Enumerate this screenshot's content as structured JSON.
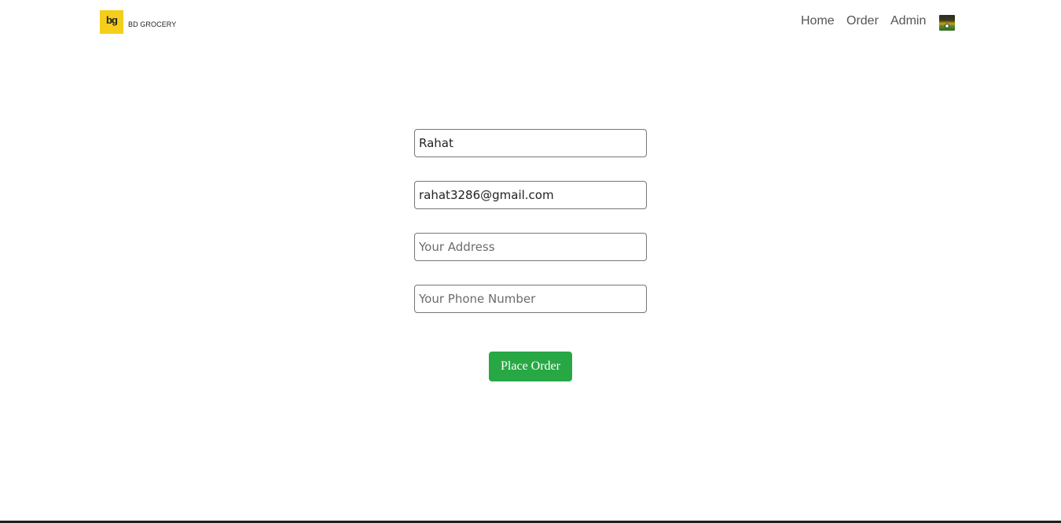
{
  "navbar": {
    "logo_text": "bg",
    "brand_name": "BD GROCERY",
    "links": {
      "home": "Home",
      "order": "Order",
      "admin": "Admin"
    }
  },
  "form": {
    "name_value": "Rahat",
    "email_value": "rahat3286@gmail.com",
    "address_placeholder": "Your Address",
    "phone_placeholder": "Your Phone Number",
    "submit_label": "Place Order"
  },
  "colors": {
    "logo_bg": "#f5cd1b",
    "submit_bg": "#28a745"
  }
}
